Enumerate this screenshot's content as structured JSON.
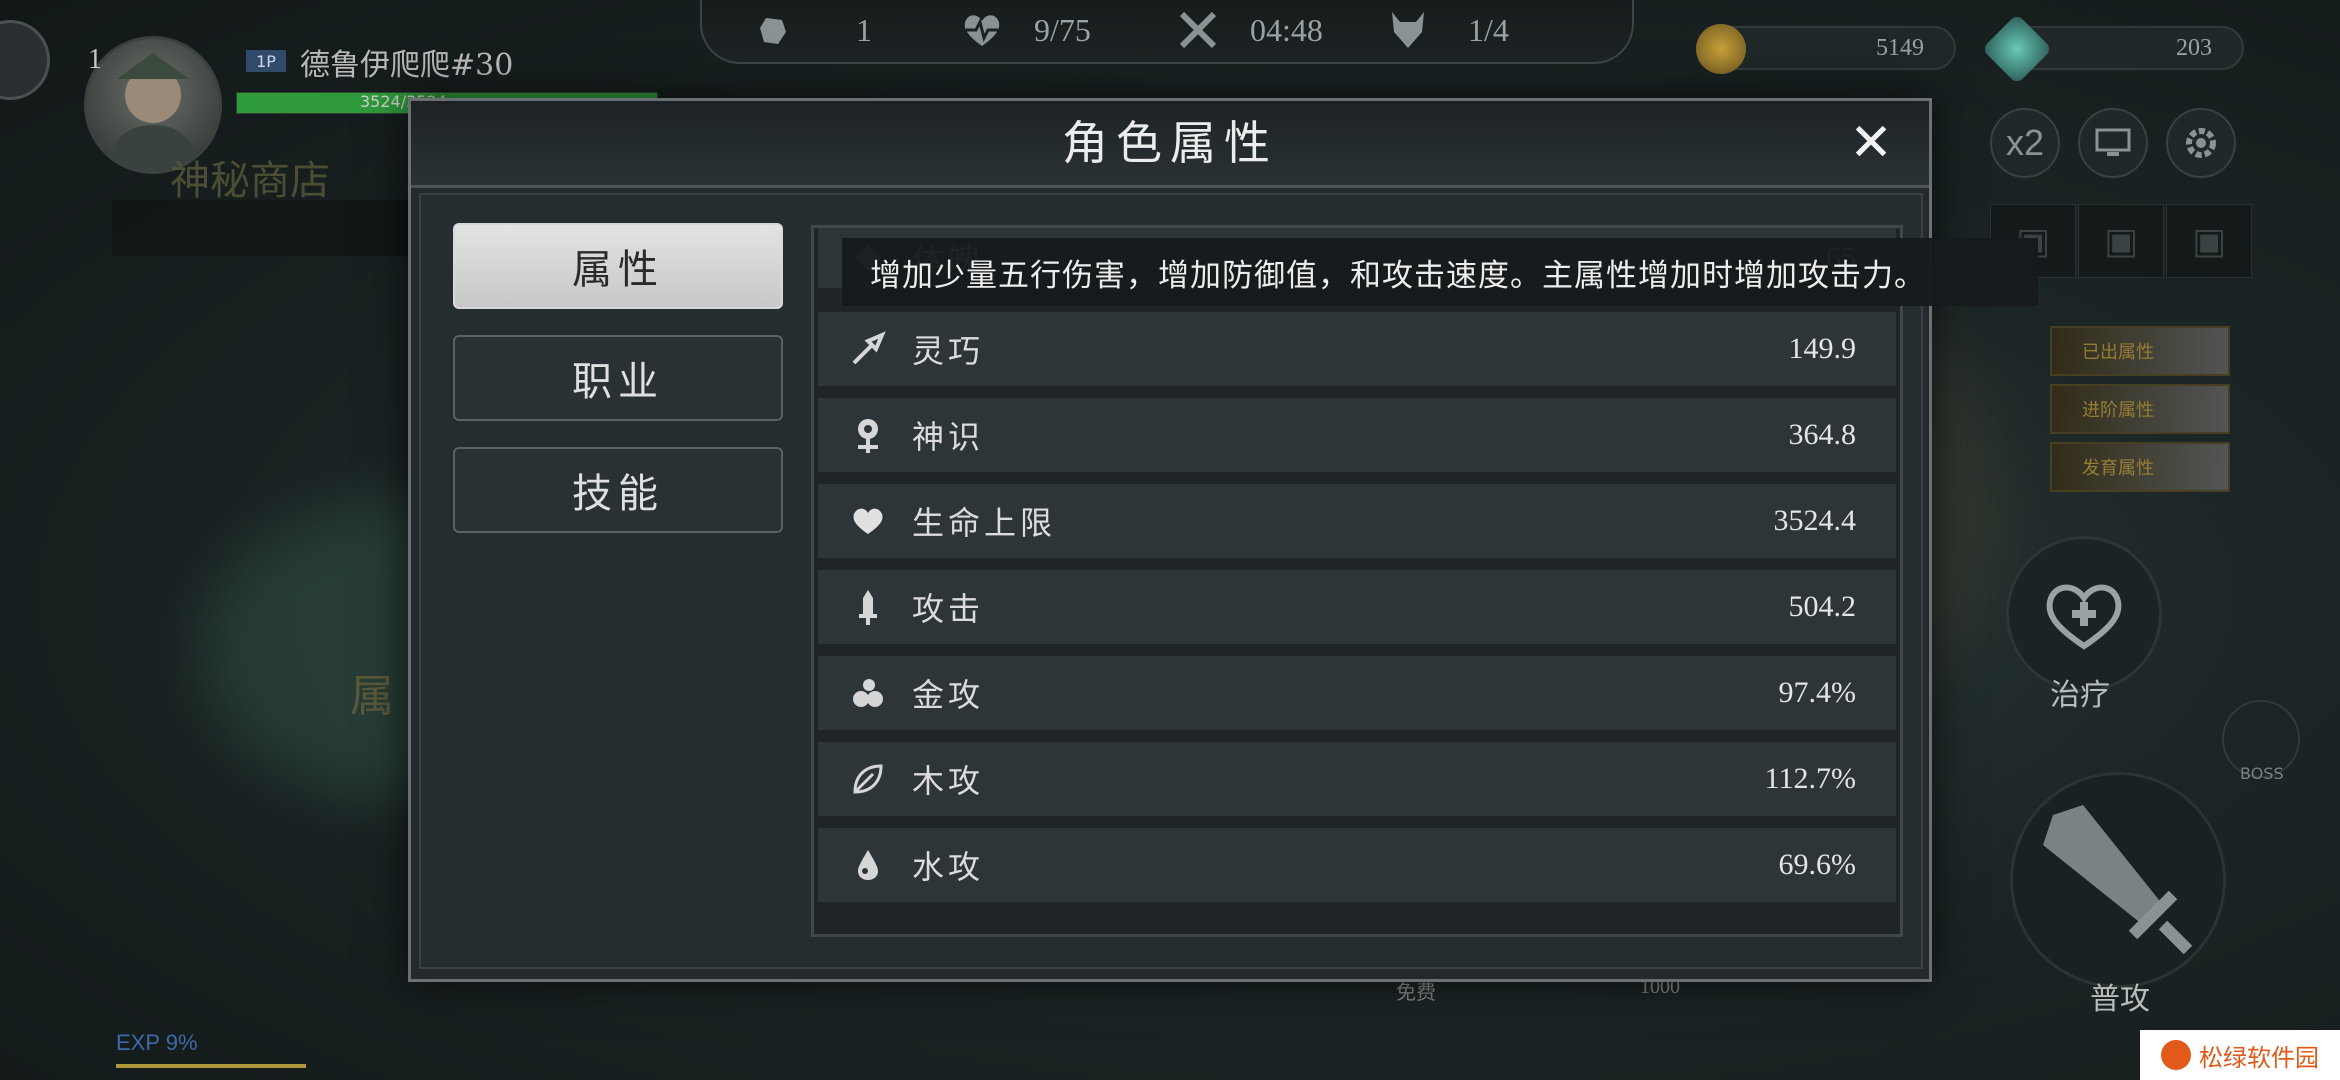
{
  "hud": {
    "level": "1",
    "player_tag": "1P",
    "player_name": "德鲁伊爬爬#30",
    "hp_text": "3524/3524",
    "shop_text": "神秘商店",
    "exp_text": "EXP 9%",
    "stats": {
      "kills": "1",
      "hp_count": "9/75",
      "timer": "04:48",
      "wave": "1/4"
    },
    "currency": {
      "gold": "5149",
      "gem": "203"
    },
    "speed_label": "x2",
    "heal_label": "治疗",
    "attack_label": "普攻",
    "boss_label": "BOSS",
    "cost_label": "免费",
    "cost_value": "1000",
    "side_tags": [
      "已出属性",
      "进阶属性",
      "发育属性"
    ],
    "field_text": "属"
  },
  "dialog": {
    "title": "角色属性",
    "close_icon": "✕",
    "tabs": [
      {
        "label": "属性",
        "active": true
      },
      {
        "label": "职业",
        "active": false
      },
      {
        "label": "技能",
        "active": false
      }
    ],
    "tooltip": "增加少量五行伤害，增加防御值，和攻击速度。主属性增加时增加攻击力。",
    "partial_row": {
      "name": "体魄",
      "value": "65"
    },
    "rows": [
      {
        "icon": "dash-icon",
        "name": "灵巧",
        "value": "149.9"
      },
      {
        "icon": "spirit-icon",
        "name": "神识",
        "value": "364.8"
      },
      {
        "icon": "heart-icon",
        "name": "生命上限",
        "value": "3524.4"
      },
      {
        "icon": "sword-icon",
        "name": "攻击",
        "value": "504.2"
      },
      {
        "icon": "metal-icon",
        "name": "金攻",
        "value": "97.4%"
      },
      {
        "icon": "leaf-icon",
        "name": "木攻",
        "value": "112.7%"
      },
      {
        "icon": "water-icon",
        "name": "水攻",
        "value": "69.6%"
      }
    ]
  },
  "watermark": "松绿软件园"
}
